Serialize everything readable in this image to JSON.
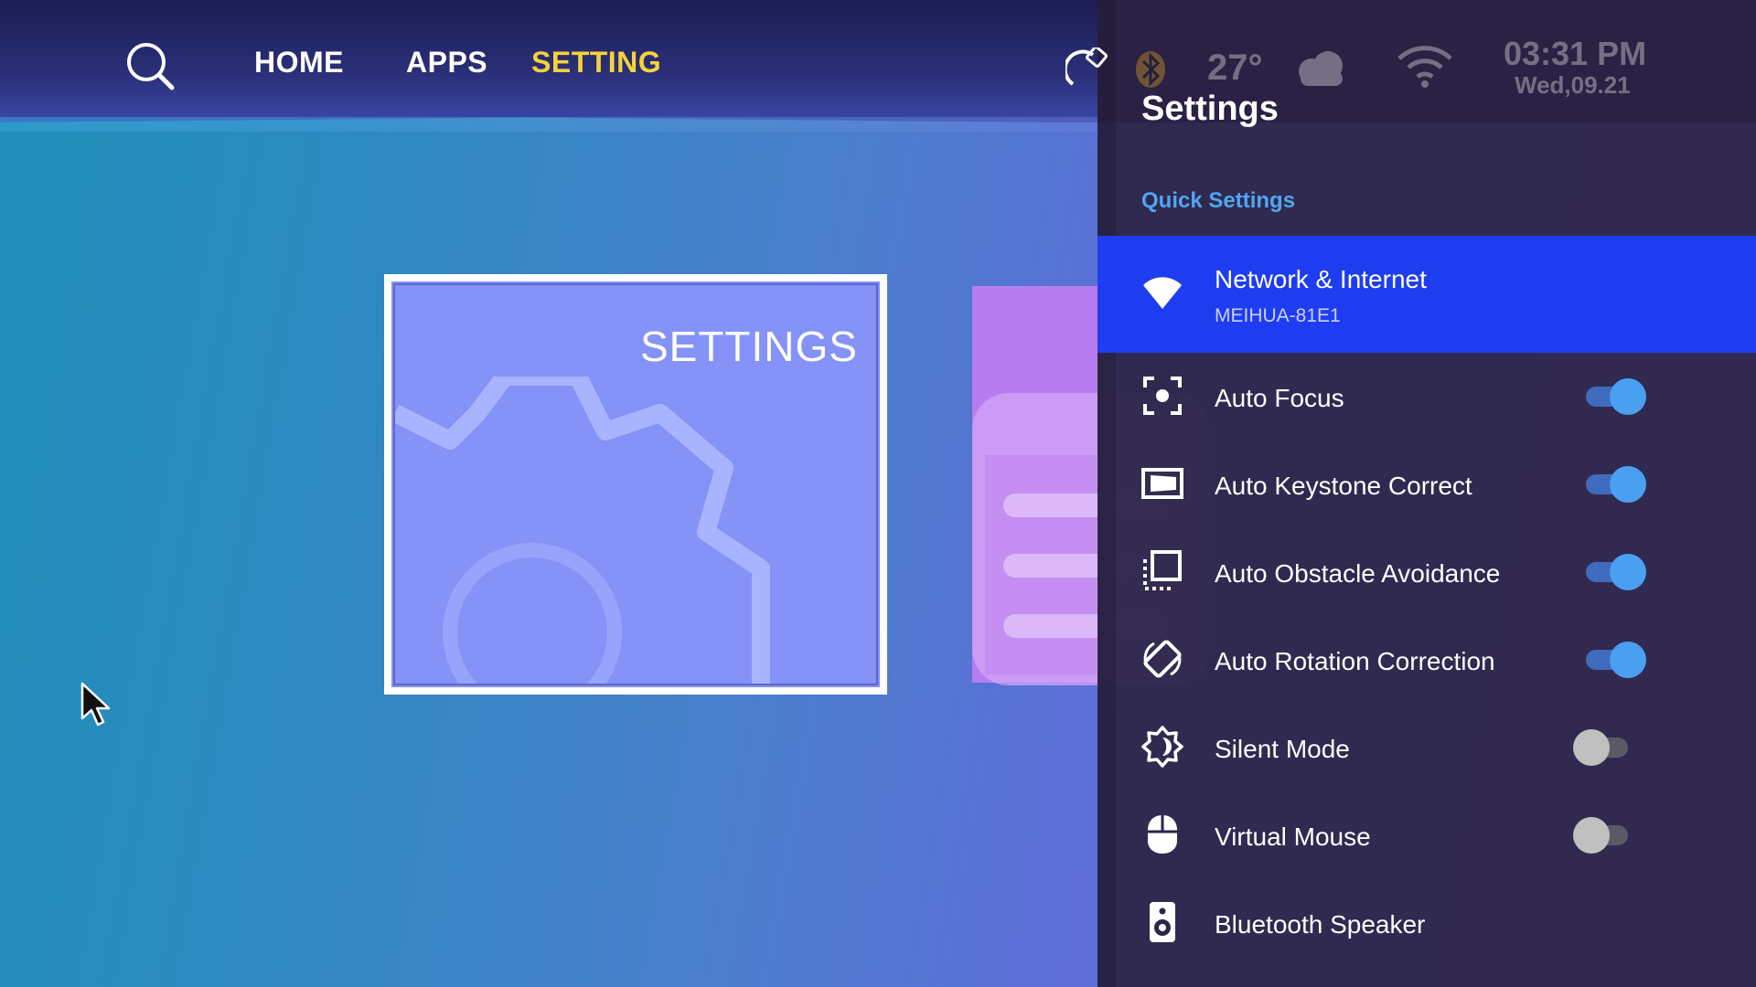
{
  "nav": {
    "home": "HOME",
    "apps": "APPS",
    "setting": "SETTING",
    "active_color": "#f5d23a"
  },
  "card": {
    "title": "SETTINGS",
    "icon": "gear-icon"
  },
  "status": {
    "temperature": "27°",
    "time": "03:31 PM",
    "date": "Wed,09.21",
    "icons": [
      "rotate-icon",
      "bluetooth-icon",
      "cloud-icon",
      "wifi-icon"
    ]
  },
  "panel": {
    "title": "Settings",
    "section": "Quick Settings",
    "accent": "#1f3df0",
    "items": [
      {
        "label": "Network & Internet",
        "sub": "MEIHUA-81E1",
        "icon": "wifi-icon",
        "selected": true
      },
      {
        "label": "Auto Focus",
        "icon": "focus-icon",
        "toggle": "on"
      },
      {
        "label": "Auto Keystone Correct",
        "icon": "keystone-icon",
        "toggle": "on"
      },
      {
        "label": "Auto Obstacle Avoidance",
        "icon": "obstacle-icon",
        "toggle": "on"
      },
      {
        "label": "Auto Rotation Correction",
        "icon": "rotation-icon",
        "toggle": "on"
      },
      {
        "label": "Silent Mode",
        "icon": "brightness-icon",
        "toggle": "off"
      },
      {
        "label": "Virtual Mouse",
        "icon": "mouse-icon",
        "toggle": "off"
      },
      {
        "label": "Bluetooth Speaker",
        "icon": "speaker-icon"
      }
    ]
  }
}
